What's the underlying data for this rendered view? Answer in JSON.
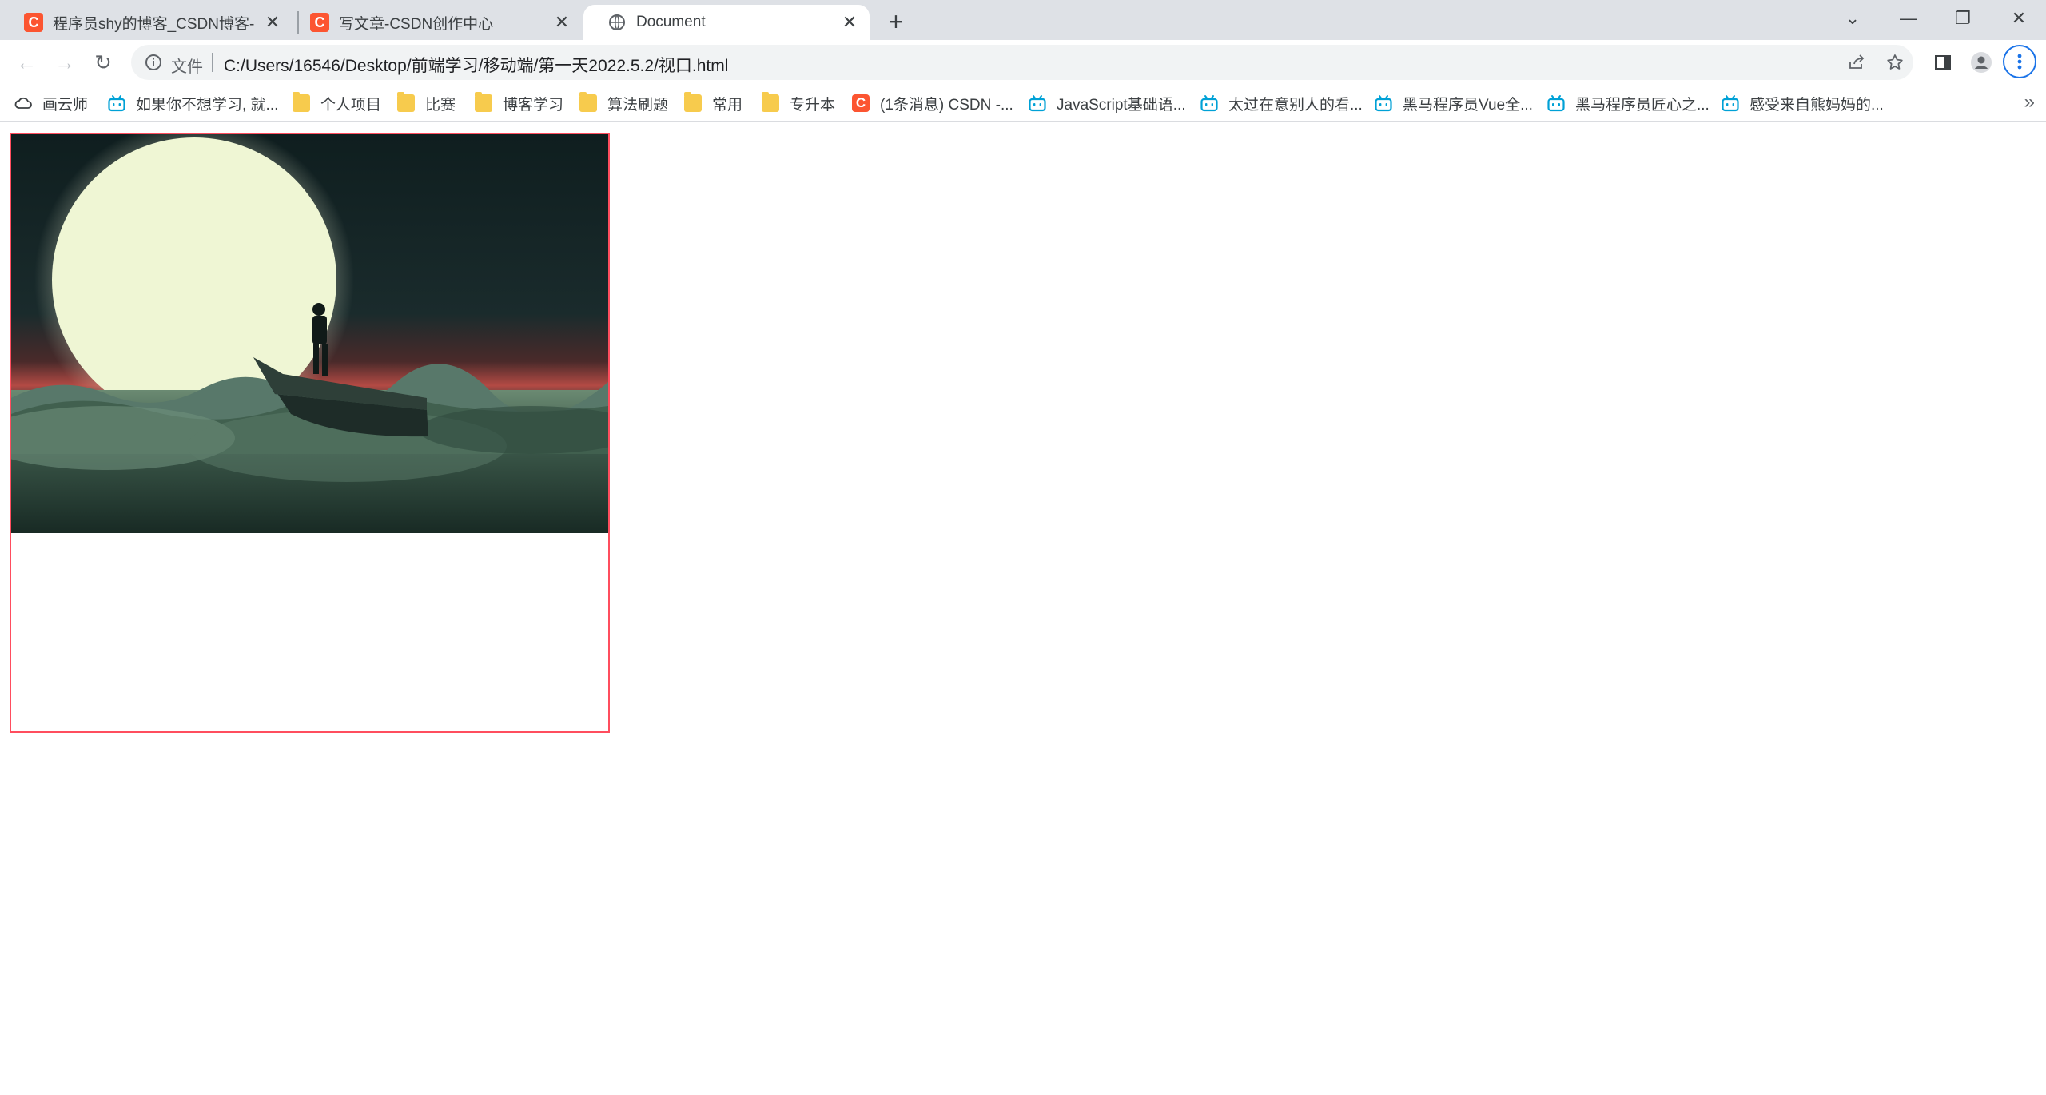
{
  "tabs": [
    {
      "title": "程序员shy的博客_CSDN博客-《",
      "favicon": "csdn-icon"
    },
    {
      "title": "写文章-CSDN创作中心",
      "favicon": "csdn-icon"
    },
    {
      "title": "Document",
      "favicon": "globe-icon",
      "active": true
    }
  ],
  "new_tab_label": "+",
  "window_controls": {
    "tab_search": "⌄",
    "minimize": "—",
    "restore": "❐",
    "close": "✕"
  },
  "toolbar": {
    "back": "←",
    "forward": "→",
    "reload": "↻",
    "omnibox": {
      "label": "文件",
      "url": "C:/Users/16546/Desktop/前端学习/移动端/第一天2022.5.2/视口.html"
    }
  },
  "bookmarks": [
    {
      "label": "画云师",
      "icon": "cloud-icon"
    },
    {
      "label": "如果你不想学习, 就...",
      "icon": "bilibili-icon"
    },
    {
      "label": "个人项目",
      "icon": "folder-icon"
    },
    {
      "label": "比赛",
      "icon": "folder-icon"
    },
    {
      "label": "博客学习",
      "icon": "folder-icon"
    },
    {
      "label": "算法刷题",
      "icon": "folder-icon"
    },
    {
      "label": "常用",
      "icon": "folder-icon"
    },
    {
      "label": "专升本",
      "icon": "folder-icon"
    },
    {
      "label": "(1条消息) CSDN -...",
      "icon": "csdn-icon"
    },
    {
      "label": "JavaScript基础语...",
      "icon": "bilibili-icon"
    },
    {
      "label": "太过在意别人的看...",
      "icon": "bilibili-icon"
    },
    {
      "label": "黑马程序员Vue全...",
      "icon": "bilibili-icon"
    },
    {
      "label": "黑马程序员匠心之...",
      "icon": "bilibili-icon"
    },
    {
      "label": "感受来自熊妈妈的...",
      "icon": "bilibili-icon"
    }
  ],
  "bookmarks_overflow": "»",
  "colors": {
    "tabstrip_bg": "#dee1e6",
    "box_border": "#ff4d5e",
    "csdn_red": "#fc5531",
    "bilibili_blue": "#00a1d6",
    "folder_yellow": "#f7cb4d",
    "focus_blue": "#1a73e8"
  }
}
